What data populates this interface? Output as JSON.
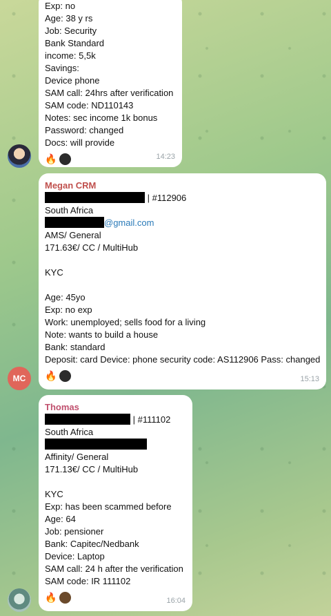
{
  "message1": {
    "lines": [
      "Exp: no",
      "Age: 38 y rs",
      "Job: Security",
      "Bank Standard",
      "income: 5,5k",
      "Savings:",
      "Device phone",
      "SAM call: 24hrs after verification",
      "SAM code: ND110143",
      "Notes: sec income 1k bonus",
      "Password: changed",
      "Docs: will provide"
    ],
    "reaction": "🔥",
    "time": "14:23"
  },
  "message2": {
    "sender": "Megan CRM",
    "avatar_initials": "MC",
    "id_suffix": "| #112906",
    "country": "South Africa",
    "email_domain": "@gmail.com",
    "lines_a": [
      "AMS/ General",
      "171.63€/ CC / MultiHub"
    ],
    "kyc": "KYC",
    "lines_b": [
      " Age: 45yo",
      "Exp: no exp",
      "Work: unemployed; sells food for a living",
      "Note: wants to build a house",
      "Bank: standard",
      "Deposit: card Device: phone security code: AS112906 Pass: changed"
    ],
    "reaction": "🔥",
    "time": "15:13"
  },
  "message3": {
    "sender": "Thomas",
    "id_suffix": "| #111102",
    "country": "South Africa",
    "lines_a": [
      "Affinity/ General",
      "171.13€/ CC / MultiHub"
    ],
    "lines_b": [
      "KYC",
      "Exp: has been scammed before",
      "Age: 64",
      "Job: pensioner",
      "Bank: Capitec/Nedbank",
      "Device: Laptop",
      "SAM call: 24 h after the verification",
      "SAM code: IR 111102"
    ],
    "reaction": "🔥",
    "time": "16:04"
  }
}
